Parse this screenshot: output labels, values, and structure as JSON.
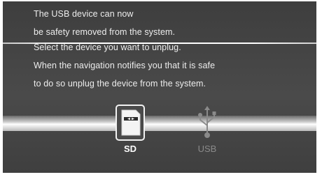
{
  "message": {
    "lines": [
      "The USB device can now",
      "be safety removed from the system.",
      "Select the device you want to unplug.",
      "When the navigation notifies you that it is safe",
      "to do so unplug the device from the system."
    ]
  },
  "devices": [
    {
      "label": "SD",
      "icon": "sd-card-icon",
      "state": "selected"
    },
    {
      "label": "USB",
      "icon": "usb-icon",
      "state": "disabled"
    }
  ],
  "colors": {
    "background": "#454545",
    "text": "#ededed",
    "disabled": "#8a8a8a"
  }
}
